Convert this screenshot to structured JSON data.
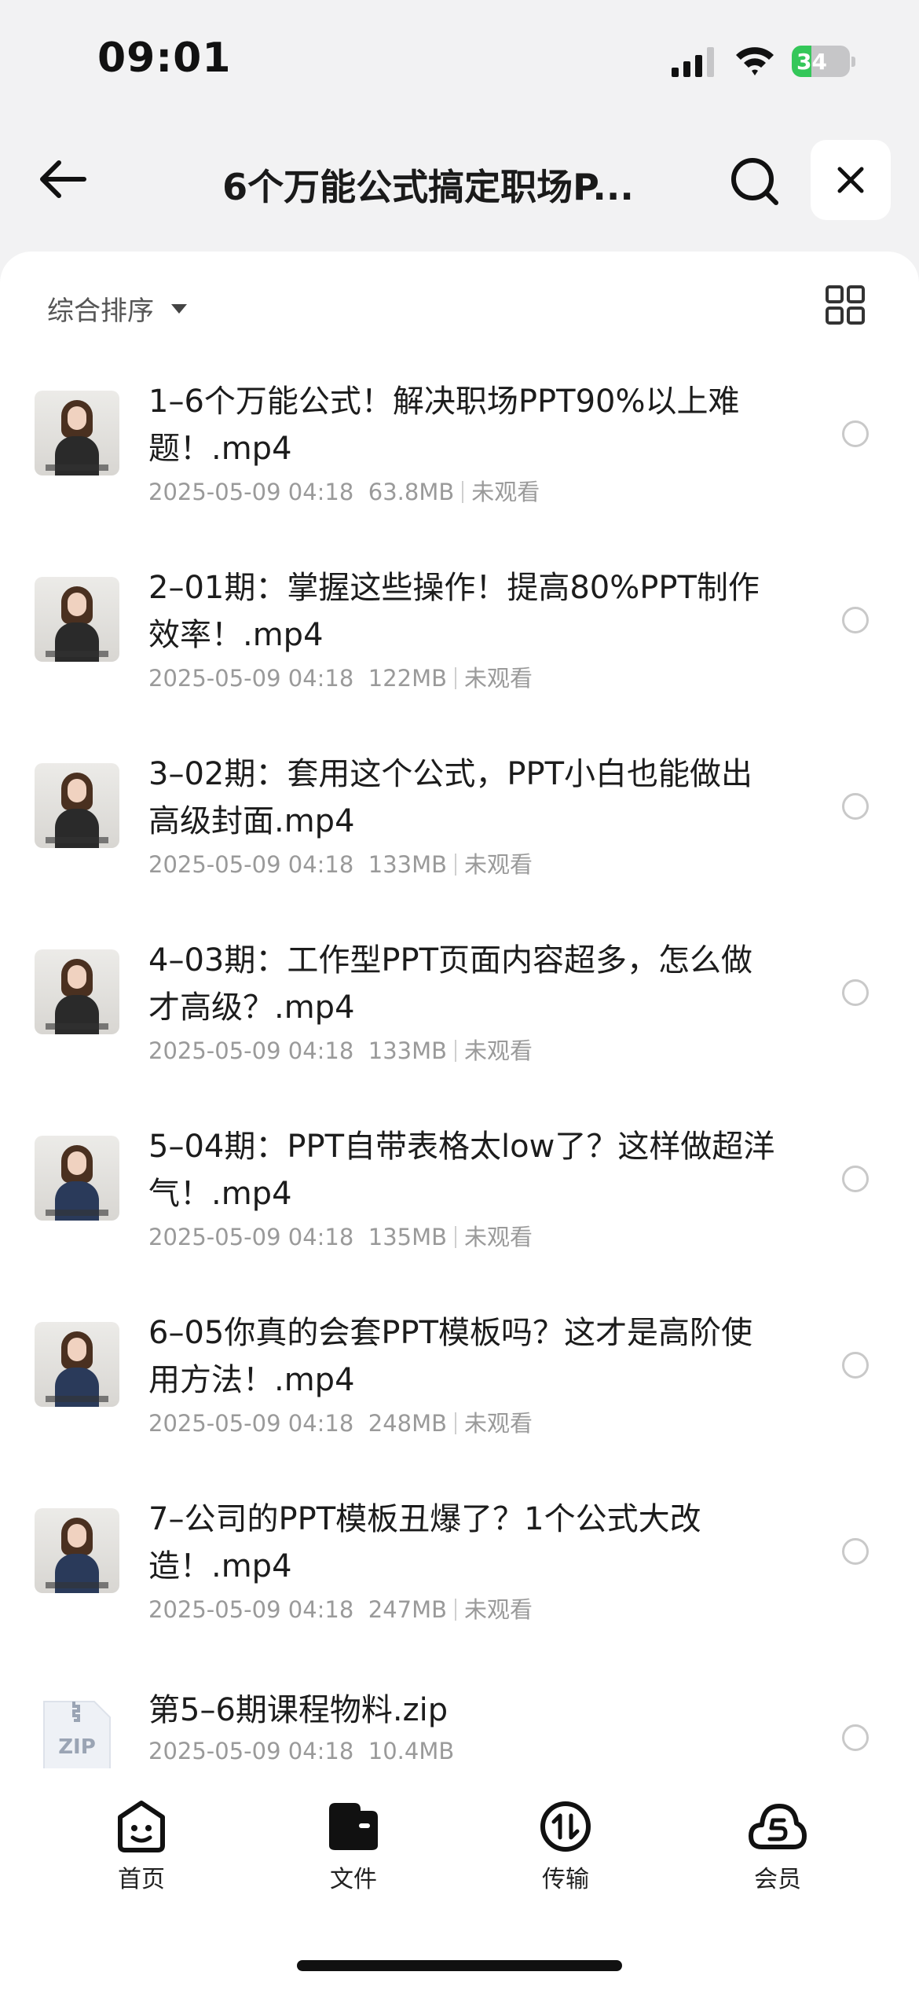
{
  "status_bar": {
    "time": "09:01",
    "battery_level": "34",
    "battery_percent": 0.34,
    "icons": [
      "signal-icon",
      "wifi-icon",
      "battery-charging-icon"
    ]
  },
  "header": {
    "title": "6个万能公式搞定职场P...",
    "icons": [
      "back-arrow-icon",
      "search-icon",
      "close-icon"
    ]
  },
  "toolbar": {
    "sort_label": "综合排序",
    "icons": [
      "caret-down-icon",
      "grid-view-icon"
    ]
  },
  "files": [
    {
      "name": "1–6个万能公式！解决职场PPT90%以上难题！.mp4",
      "date": "2025-05-09 04:18",
      "size": "63.8MB",
      "status": "未观看",
      "type": "video"
    },
    {
      "name": "2–01期：掌握这些操作！提高80%PPT制作效率！.mp4",
      "date": "2025-05-09 04:18",
      "size": "122MB",
      "status": "未观看",
      "type": "video"
    },
    {
      "name": "3–02期：套用这个公式，PPT小白也能做出高级封面.mp4",
      "date": "2025-05-09 04:18",
      "size": "133MB",
      "status": "未观看",
      "type": "video"
    },
    {
      "name": "4–03期：工作型PPT页面内容超多，怎么做才高级？.mp4",
      "date": "2025-05-09 04:18",
      "size": "133MB",
      "status": "未观看",
      "type": "video"
    },
    {
      "name": "5–04期：PPT自带表格太low了？这样做超洋气！.mp4",
      "date": "2025-05-09 04:18",
      "size": "135MB",
      "status": "未观看",
      "type": "video"
    },
    {
      "name": "6–05你真的会套PPT模板吗？这才是高阶使用方法！.mp4",
      "date": "2025-05-09 04:18",
      "size": "248MB",
      "status": "未观看",
      "type": "video"
    },
    {
      "name": "7–公司的PPT模板丑爆了？1个公式大改造！.mp4",
      "date": "2025-05-09 04:18",
      "size": "247MB",
      "status": "未观看",
      "type": "video"
    },
    {
      "name": "第5–6期课程物料.zip",
      "date": "2025-05-09 04:18",
      "size": "10.4MB",
      "status": "",
      "type": "zip",
      "icon_label": "ZIP"
    }
  ],
  "tab_bar": {
    "tabs": [
      {
        "label": "首页",
        "icon": "home-face-icon"
      },
      {
        "label": "文件",
        "icon": "folder-icon"
      },
      {
        "label": "传输",
        "icon": "transfer-icon"
      },
      {
        "label": "会员",
        "icon": "vip-cloud-icon"
      }
    ]
  }
}
